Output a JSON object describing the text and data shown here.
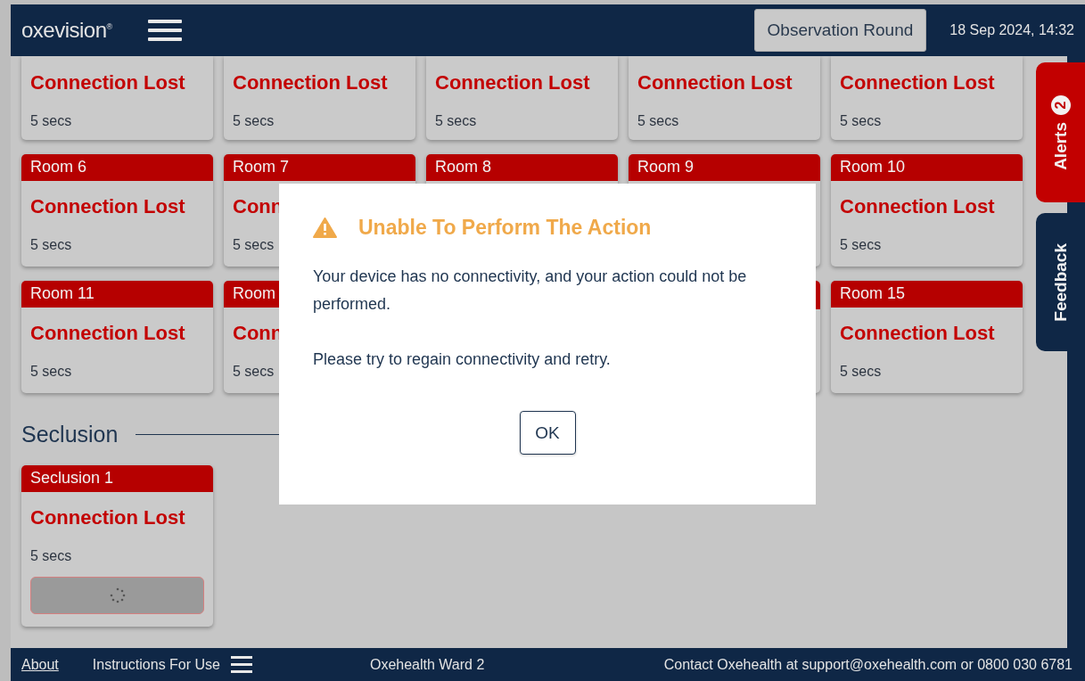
{
  "header": {
    "logo": "oxevision",
    "logo_mark": "®",
    "round_button": "Observation Round",
    "datetime": "18 Sep 2024, 14:32"
  },
  "rooms": [
    {
      "status": "Connection Lost",
      "time": "5 secs"
    },
    {
      "status": "Connection Lost",
      "time": "5 secs"
    },
    {
      "status": "Connection Lost",
      "time": "5 secs"
    },
    {
      "status": "Connection Lost",
      "time": "5 secs"
    },
    {
      "status": "Connection Lost",
      "time": "5 secs"
    },
    {
      "label": "Room 6",
      "status": "Connection Lost",
      "time": "5 secs"
    },
    {
      "label": "Room 7",
      "status": "Conn",
      "time": "5 secs"
    },
    {
      "label": "Room 8"
    },
    {
      "label": "Room 9"
    },
    {
      "label": "Room 10",
      "status": "Connection Lost",
      "time": "5 secs"
    },
    {
      "label": "Room 11",
      "status": "Connection Lost",
      "time": "5 secs"
    },
    {
      "label": "Room",
      "status": "Conn",
      "time": "5 secs"
    },
    {
      "kind": "covered"
    },
    {
      "kind": "covered"
    },
    {
      "label": "Room 15",
      "status": "Connection Lost",
      "time": "5 secs"
    }
  ],
  "seclusion": {
    "title": "Seclusion",
    "rooms": [
      {
        "label": "Seclusion 1",
        "status": "Connection Lost",
        "time": "5 secs",
        "loading": true
      }
    ]
  },
  "side_tabs": [
    {
      "kind": "alerts",
      "label": "Alerts",
      "count": "2"
    },
    {
      "kind": "feedback",
      "label": "Feedback"
    }
  ],
  "dialog": {
    "title": "Unable To Perform The Action",
    "paragraphs": [
      "Your device has no connectivity, and your action could not be performed.",
      "Please try to regain connectivity and retry."
    ],
    "button": "OK"
  },
  "footer": {
    "about": "About",
    "instructions": "Instructions For Use",
    "ward": "Oxehealth Ward 2",
    "contact": "Contact Oxehealth at support@oxehealth.com or 0800 030 6781"
  }
}
